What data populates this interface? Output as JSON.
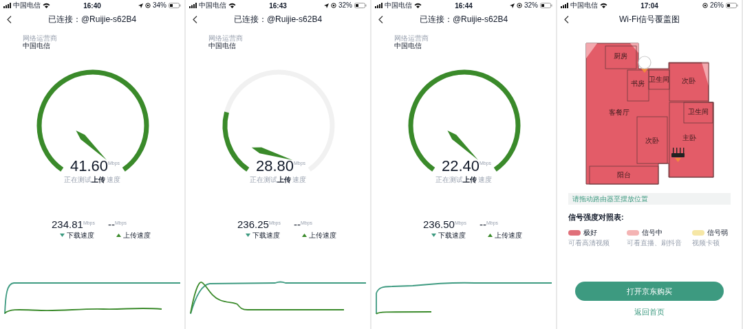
{
  "screens": [
    {
      "kind": "speedtest",
      "status_bar": {
        "carrier": "中国电信",
        "time": "16:40",
        "location": true,
        "battery": "34%"
      },
      "title": "已连接：@Ruijie-s62B4",
      "isp": {
        "label": "网络运营商",
        "name": "中国电信"
      },
      "gauge": {
        "arc": {
          "level": 1
        },
        "value": "41.60",
        "unit": "Mbps",
        "caption": "正在测试**上传** 速度"
      },
      "stats": [
        {
          "kind": "download",
          "value": "234.81",
          "unit": "Mbps",
          "label": "下载速度"
        },
        {
          "kind": "upload",
          "value": "--",
          "unit": "Mbps",
          "label": "上传速度"
        }
      ]
    },
    {
      "kind": "speedtest",
      "status_bar": {
        "carrier": "中国电信",
        "time": "16:43",
        "location": true,
        "battery": "32%"
      },
      "title": "已连接：@Ruijie-s62B4",
      "isp": {
        "label": "网络运营商",
        "name": "中国电信"
      },
      "gauge": {
        "arc": {
          "level": 0.24
        },
        "value": "28.80",
        "unit": "Mbps",
        "caption": "正在测试**上传** 速度"
      },
      "stats": [
        {
          "kind": "download",
          "value": "236.25",
          "unit": "Mbps",
          "label": "下载速度"
        },
        {
          "kind": "upload",
          "value": "--",
          "unit": "Mbps",
          "label": "上传速度"
        }
      ]
    },
    {
      "kind": "speedtest",
      "status_bar": {
        "carrier": "中国电信",
        "time": "16:44",
        "location": true,
        "battery": "32%"
      },
      "title": "已连接：@Ruijie-s62B4",
      "isp": {
        "label": "网络运营商",
        "name": "中国电信"
      },
      "gauge": {
        "arc": {
          "level": 1
        },
        "value": "22.40",
        "unit": "Mbps",
        "caption": "正在测试**上传** 速度"
      },
      "stats": [
        {
          "kind": "download",
          "value": "236.50",
          "unit": "Mbps",
          "label": "下载速度"
        },
        {
          "kind": "upload",
          "value": "--",
          "unit": "Mbps",
          "label": "上传速度"
        }
      ]
    },
    {
      "kind": "coverage",
      "status_bar": {
        "carrier": "中国电信",
        "time": "17:04",
        "location": false,
        "battery": "26%"
      },
      "title": "Wi-Fi信号覆盖图",
      "rooms": [
        "厨房",
        "书房",
        "卫生间",
        "次卧",
        "客餐厅",
        "卫生间",
        "次卧",
        "主卧",
        "阳台"
      ],
      "hint": "请拖动路由器至摆放位置",
      "legend_title": "信号强度对照表:",
      "legend": [
        {
          "label": "极好",
          "note": "可看高清视频",
          "color": "#e0707a"
        },
        {
          "label": "信号中",
          "note": "可看直播、刷抖音",
          "color": "#f4b4b4"
        },
        {
          "label": "信号弱",
          "note": "视频卡顿",
          "color": "#f6e7a6"
        }
      ],
      "buy_button": "打开京东购买",
      "home_link": "返回首页"
    }
  ]
}
